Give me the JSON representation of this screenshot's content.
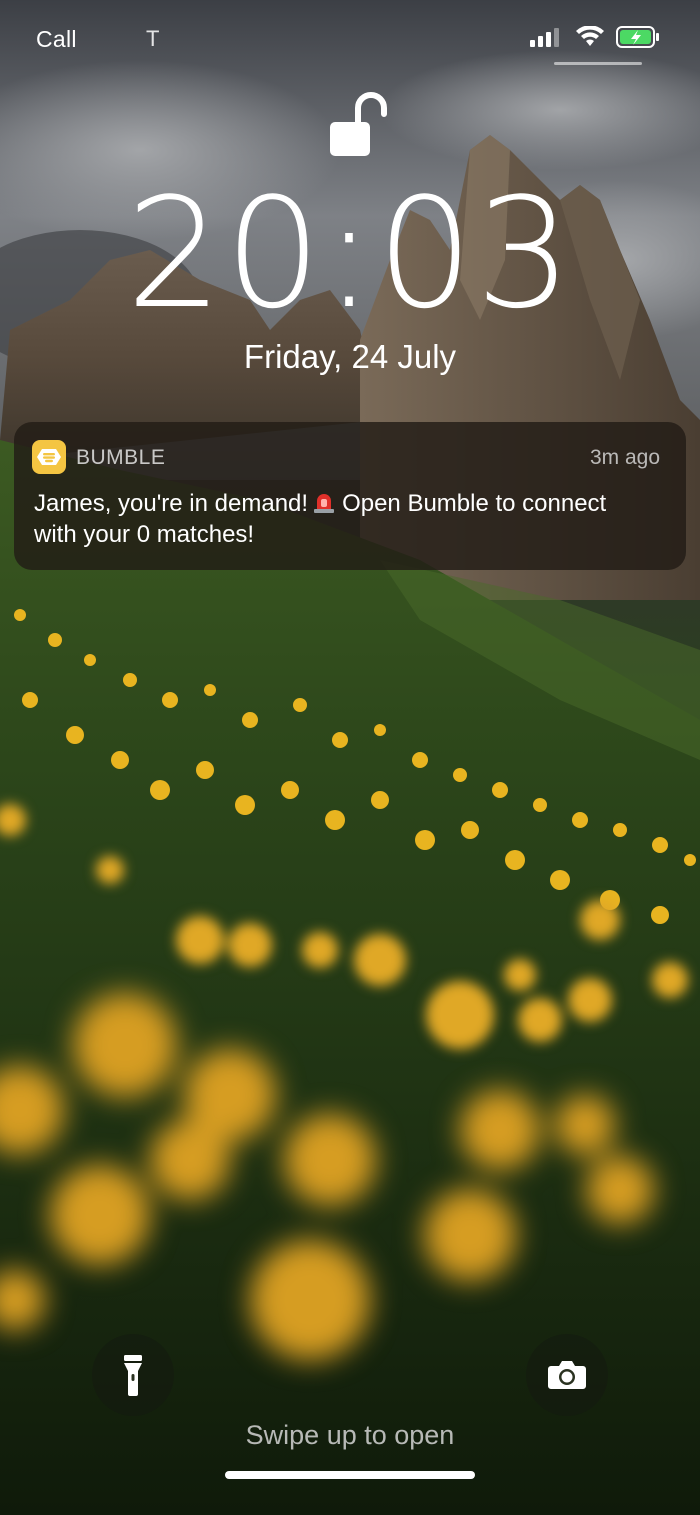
{
  "status_bar": {
    "carrier": "Call",
    "carrier_extra": "T",
    "icons": [
      "cellular-signal-icon",
      "wifi-icon",
      "battery-charging-icon"
    ]
  },
  "lock_screen": {
    "lock_icon": "lock-open-icon",
    "time": "20:03",
    "date": "Friday, 24 July"
  },
  "notification": {
    "app_name": "BUMBLE",
    "time_ago": "3m ago",
    "message_part1": "James, you're in demand!",
    "message_part2": "Open Bumble to connect with your 0 matches!",
    "emoji_icon": "police-siren-icon"
  },
  "controls": {
    "left_icon": "flashlight-icon",
    "right_icon": "camera-icon",
    "swipe_hint": "Swipe up to open"
  },
  "colors": {
    "bumble_yellow": "#f4c542",
    "text": "#ffffff"
  }
}
